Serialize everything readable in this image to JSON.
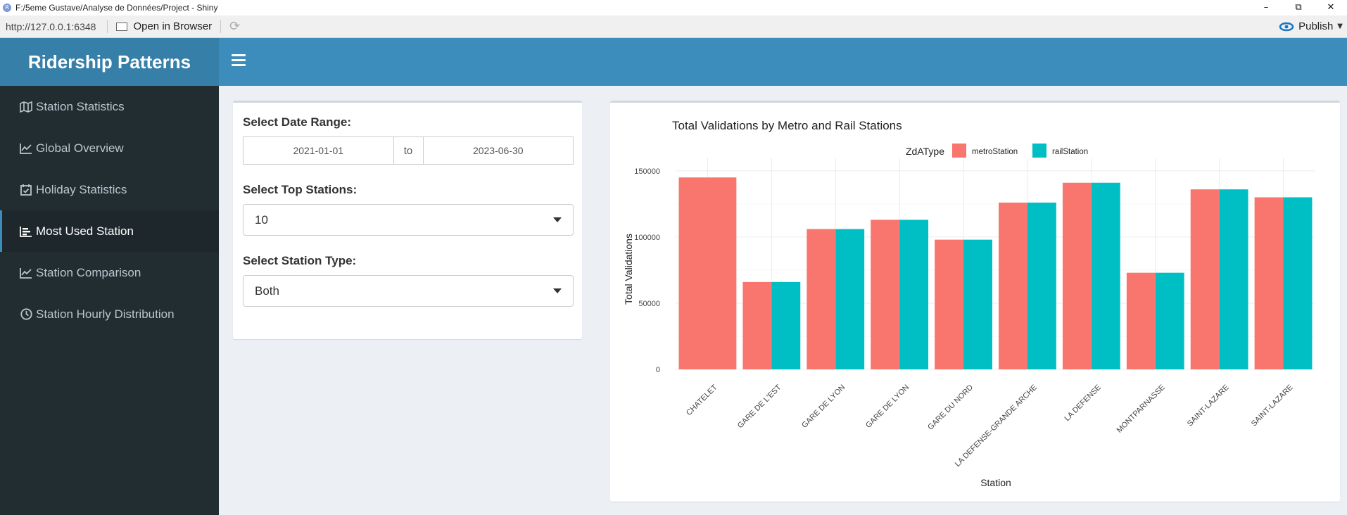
{
  "window": {
    "title": "F:/5eme Gustave/Analyse de Données/Project - Shiny",
    "app_icon_letter": "R"
  },
  "address_bar": {
    "url": "http://127.0.0.1:6348",
    "open_in_browser": "Open in Browser",
    "publish": "Publish"
  },
  "header": {
    "title": "Ridership Patterns"
  },
  "sidebar": {
    "items": [
      {
        "label": "Station Statistics",
        "icon": "map-icon"
      },
      {
        "label": "Global Overview",
        "icon": "line-chart-icon"
      },
      {
        "label": "Holiday Statistics",
        "icon": "calendar-check-icon"
      },
      {
        "label": "Most Used Station",
        "icon": "bar-chart-icon",
        "active": true
      },
      {
        "label": "Station Comparison",
        "icon": "line-chart-icon"
      },
      {
        "label": "Station Hourly Distribution",
        "icon": "clock-icon"
      }
    ]
  },
  "controls": {
    "date_range_label": "Select Date Range:",
    "date_start": "2021-01-01",
    "date_sep": "to",
    "date_end": "2023-06-30",
    "top_stations_label": "Select Top Stations:",
    "top_stations_value": "10",
    "station_type_label": "Select Station Type:",
    "station_type_value": "Both"
  },
  "colors": {
    "metro": "#F8766D",
    "rail": "#00BFC4",
    "navbar": "#3c8dbc",
    "logo": "#367fa9",
    "sidebar": "#222d32"
  },
  "chart_data": {
    "type": "bar",
    "title": "Total Validations by Metro and Rail Stations",
    "xlabel": "Station",
    "ylabel": "Total Validations",
    "legend_title": "ZdAType",
    "legend_position": "top",
    "ylim": [
      0,
      160000
    ],
    "yticks": [
      0,
      50000,
      100000,
      150000
    ],
    "grid": true,
    "categories": [
      "CHATELET",
      "GARE DE L'EST",
      "GARE DE LYON",
      "GARE DE LYON",
      "GARE DU NORD",
      "LA DEFENSE-GRANDE ARCHE",
      "LA DEFENSE",
      "MONTPARNASSE",
      "SAINT-LAZARE",
      "SAINT-LAZARE"
    ],
    "series": [
      {
        "name": "metroStation",
        "values": [
          145000,
          66000,
          106000,
          113000,
          98000,
          126000,
          141000,
          73000,
          136000,
          130000
        ]
      },
      {
        "name": "railStation",
        "values": [
          null,
          66000,
          106000,
          113000,
          98000,
          126000,
          141000,
          73000,
          136000,
          130000
        ]
      }
    ]
  }
}
